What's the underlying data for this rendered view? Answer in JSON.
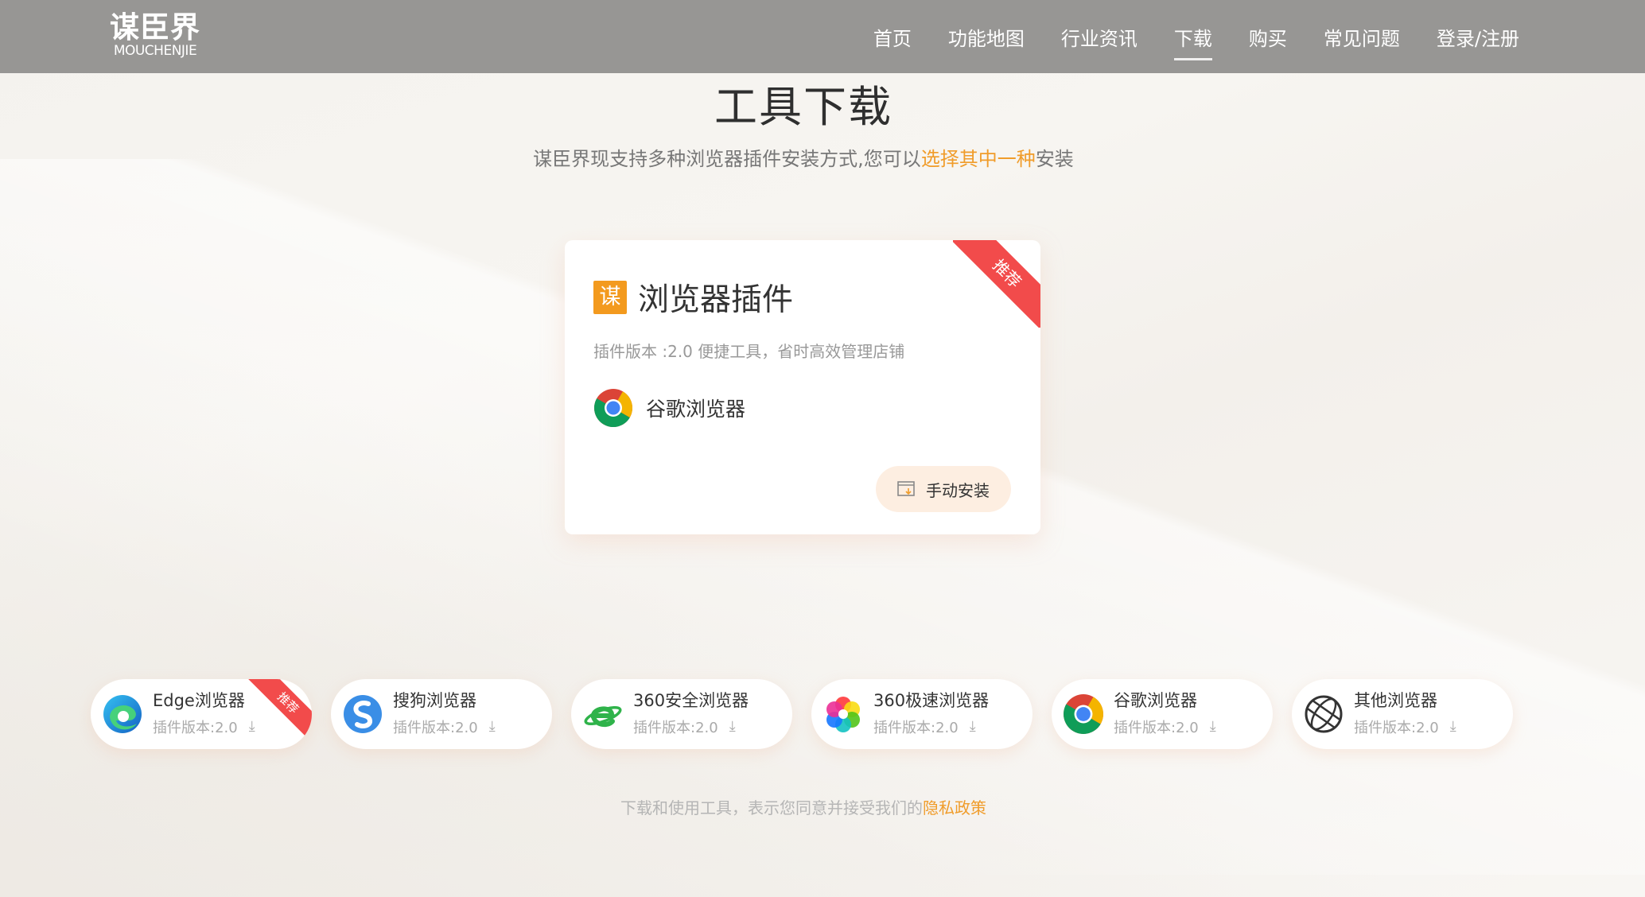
{
  "header": {
    "logo_cn": "谋臣界",
    "logo_en": "MOUCHENJIE",
    "nav": [
      "首页",
      "功能地图",
      "行业资讯",
      "下载",
      "购买",
      "常见问题",
      "登录/注册"
    ],
    "active_nav": "下载"
  },
  "hero": {
    "title": "工具下载",
    "subtitle_before": "谋臣界现支持多种浏览器插件安装方式,您可以",
    "subtitle_highlight": "选择其中一种",
    "subtitle_after": "安装"
  },
  "main_card": {
    "ribbon": "推荐",
    "brand_char": "谋",
    "title": "浏览器插件",
    "description": "插件版本 :2.0  便捷工具，省时高效管理店铺",
    "browser": "谷歌浏览器",
    "install_label": "手动安装"
  },
  "browsers": [
    {
      "name": "Edge浏览器",
      "version": "插件版本:2.0",
      "icon": "edge-icon",
      "ribbon": "推荐"
    },
    {
      "name": "搜狗浏览器",
      "version": "插件版本:2.0",
      "icon": "sogou-icon"
    },
    {
      "name": "360安全浏览器",
      "version": "插件版本:2.0",
      "icon": "360-safe-icon"
    },
    {
      "name": "360极速浏览器",
      "version": "插件版本:2.0",
      "icon": "360-speed-icon"
    },
    {
      "name": "谷歌浏览器",
      "version": "插件版本:2.0",
      "icon": "chrome-icon"
    },
    {
      "name": "其他浏览器",
      "version": "插件版本:2.0",
      "icon": "globe-icon"
    }
  ],
  "footer": {
    "text": "下载和使用工具，表示您同意并接受我们的",
    "link": "隐私政策"
  },
  "colors": {
    "header_bg": "#979694",
    "accent_orange": "#f09c2a",
    "ribbon_red": "#f24b4b",
    "brand_orange": "#f39a1e"
  }
}
